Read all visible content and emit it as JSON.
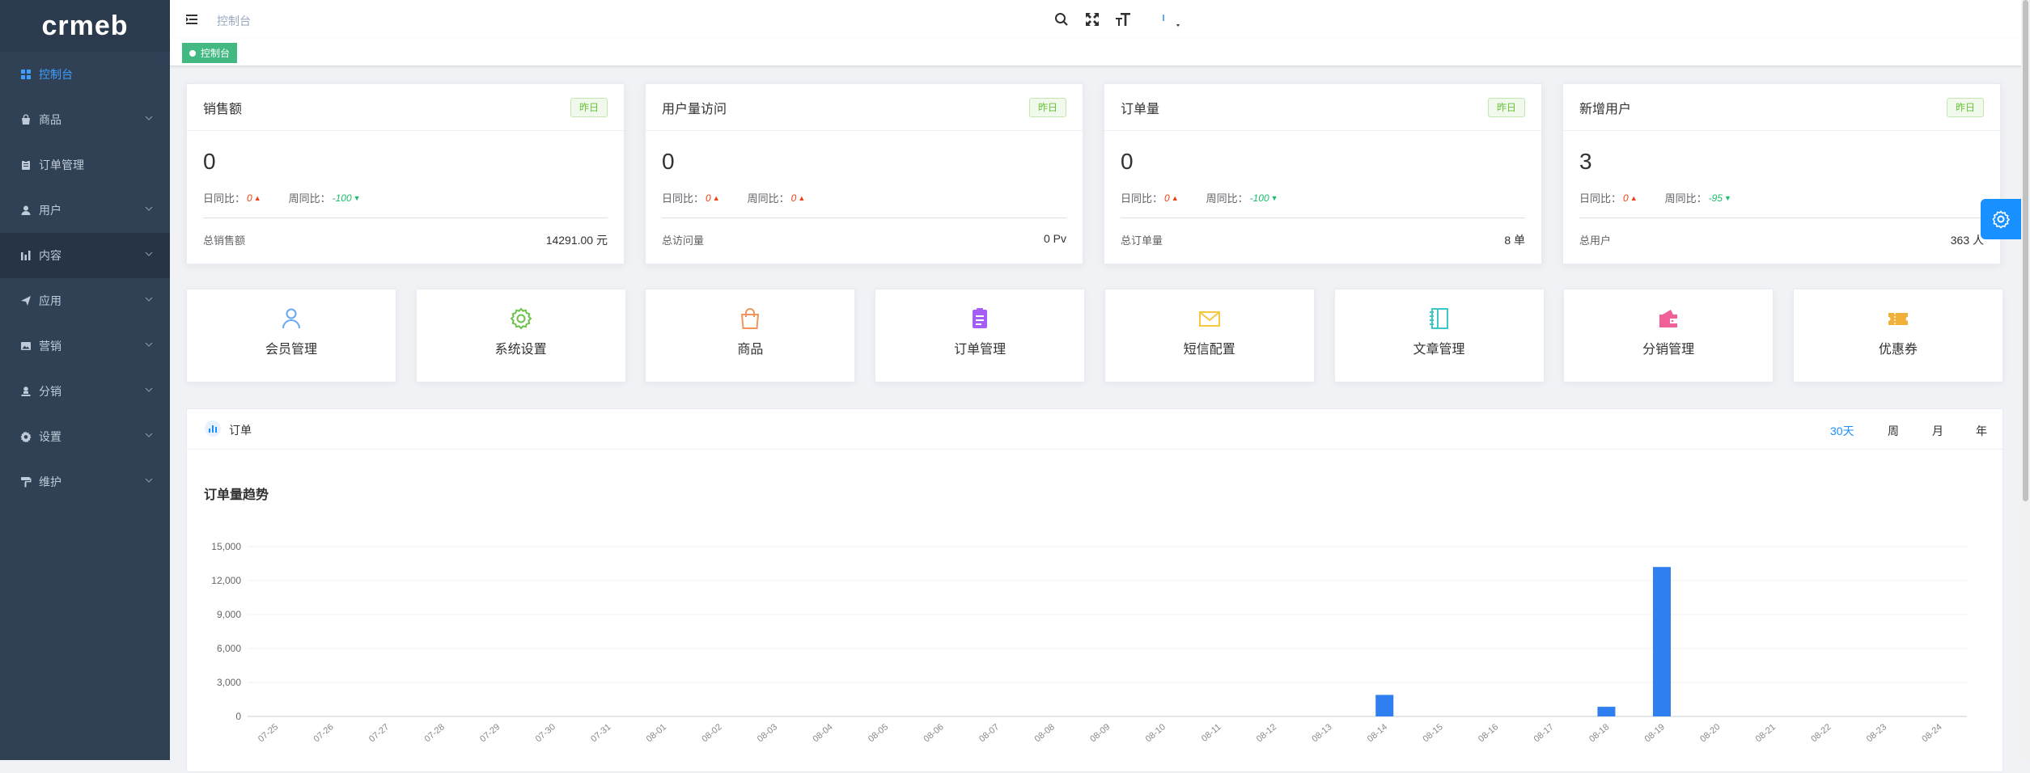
{
  "app": {
    "logo_text": "crmeb"
  },
  "sidebar": {
    "items": [
      {
        "label": "控制台",
        "icon": "dashboard-grid-icon",
        "active": true,
        "has_arrow": false
      },
      {
        "label": "商品",
        "icon": "shopping-bag-icon",
        "active": false,
        "has_arrow": true
      },
      {
        "label": "订单管理",
        "icon": "clipboard-icon",
        "active": false,
        "has_arrow": false
      },
      {
        "label": "用户",
        "icon": "user-icon",
        "active": false,
        "has_arrow": true
      },
      {
        "label": "内容",
        "icon": "bar-chart-icon",
        "active": false,
        "has_arrow": true
      },
      {
        "label": "应用",
        "icon": "paper-plane-icon",
        "active": false,
        "has_arrow": true
      },
      {
        "label": "营销",
        "icon": "picture-icon",
        "active": false,
        "has_arrow": true
      },
      {
        "label": "分销",
        "icon": "person-stamp-icon",
        "active": false,
        "has_arrow": true
      },
      {
        "label": "设置",
        "icon": "gear-icon",
        "active": false,
        "has_arrow": true
      },
      {
        "label": "维护",
        "icon": "paint-roller-icon",
        "active": false,
        "has_arrow": true
      }
    ]
  },
  "navbar": {
    "breadcrumb": "控制台"
  },
  "tags": {
    "dashboard": "控制台"
  },
  "stats": [
    {
      "title": "销售额",
      "badge": "昨日",
      "value": "0",
      "day_label": "日同比：",
      "day_value": "0",
      "day_trend": "up",
      "week_label": "周同比：",
      "week_value": "-100",
      "week_trend": "down",
      "total_label": "总销售额",
      "total_value": "14291.00 元"
    },
    {
      "title": "用户量访问",
      "badge": "昨日",
      "value": "0",
      "day_label": "日同比：",
      "day_value": "0",
      "day_trend": "up",
      "week_label": "周同比：",
      "week_value": "0",
      "week_trend": "up",
      "total_label": "总访问量",
      "total_value": "0 Pv"
    },
    {
      "title": "订单量",
      "badge": "昨日",
      "value": "0",
      "day_label": "日同比：",
      "day_value": "0",
      "day_trend": "up",
      "week_label": "周同比：",
      "week_value": "-100",
      "week_trend": "down",
      "total_label": "总订单量",
      "total_value": "8 单"
    },
    {
      "title": "新增用户",
      "badge": "昨日",
      "value": "3",
      "day_label": "日同比：",
      "day_value": "0",
      "day_trend": "up",
      "week_label": "周同比：",
      "week_value": "-95",
      "week_trend": "down",
      "total_label": "总用户",
      "total_value": "363 人"
    }
  ],
  "shortcuts": [
    {
      "label": "会员管理",
      "icon": "member-icon",
      "color": "#69a8f0"
    },
    {
      "label": "系统设置",
      "icon": "settings-gear-icon",
      "color": "#6cc24a"
    },
    {
      "label": "商品",
      "icon": "shopping-bag-icon",
      "color": "#f0955e"
    },
    {
      "label": "订单管理",
      "icon": "order-clipboard-icon",
      "color": "#a55ef5"
    },
    {
      "label": "短信配置",
      "icon": "envelope-icon",
      "color": "#f5c842"
    },
    {
      "label": "文章管理",
      "icon": "notebook-icon",
      "color": "#3ec7c4"
    },
    {
      "label": "分销管理",
      "icon": "wallet-icon",
      "color": "#f2609a"
    },
    {
      "label": "优惠券",
      "icon": "coupon-ticket-icon",
      "color": "#f0b03a"
    }
  ],
  "order_panel": {
    "header": "订单",
    "ranges": [
      "30天",
      "周",
      "月",
      "年"
    ],
    "active_range": "30天"
  },
  "chart_data": {
    "type": "bar",
    "title": "订单量趋势",
    "categories": [
      "07-25",
      "07-26",
      "07-27",
      "07-28",
      "07-29",
      "07-30",
      "07-31",
      "08-01",
      "08-02",
      "08-03",
      "08-04",
      "08-05",
      "08-06",
      "08-07",
      "08-08",
      "08-09",
      "08-10",
      "08-11",
      "08-12",
      "08-13",
      "08-14",
      "08-15",
      "08-16",
      "08-17",
      "08-18",
      "08-19",
      "08-20",
      "08-21",
      "08-22",
      "08-23",
      "08-24"
    ],
    "values": [
      0,
      0,
      0,
      0,
      0,
      0,
      0,
      0,
      0,
      0,
      0,
      0,
      0,
      0,
      0,
      0,
      0,
      0,
      0,
      0,
      1900,
      0,
      0,
      0,
      850,
      13200,
      0,
      0,
      0,
      0,
      0
    ],
    "ylim": [
      0,
      15000
    ],
    "yticks": [
      "0",
      "3,000",
      "6,000",
      "9,000",
      "12,000",
      "15,000"
    ],
    "ytick_values": [
      0,
      3000,
      6000,
      9000,
      12000,
      15000
    ],
    "grid": true,
    "color": "#2f7ff0"
  }
}
